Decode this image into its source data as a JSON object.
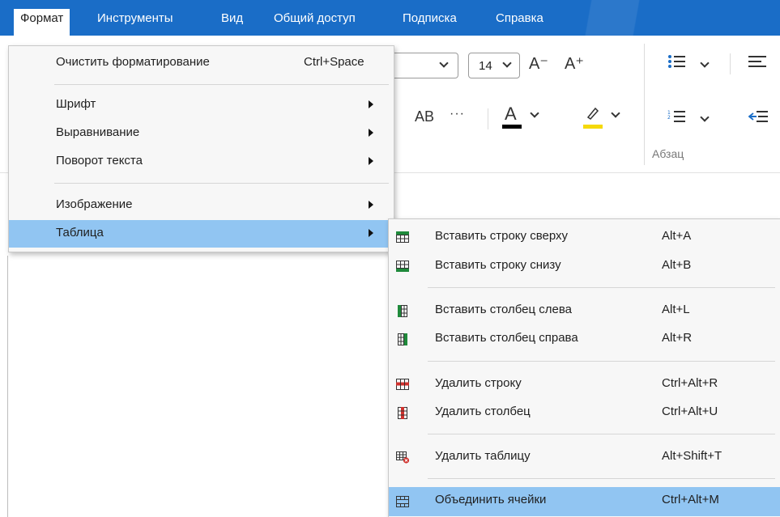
{
  "menubar": {
    "items": [
      {
        "label": "Формат"
      },
      {
        "label": "Инструменты"
      },
      {
        "label": "Вид"
      },
      {
        "label": "Общий доступ"
      },
      {
        "label": "Подписка"
      },
      {
        "label": "Справка"
      }
    ]
  },
  "ribbon": {
    "font_size": "14",
    "font_grow": "A⁻",
    "font_shrink": "A⁺",
    "caps": "AB",
    "more": "···",
    "font_color_glyph": "A",
    "group_paragraph": "Абзац",
    "colors": {
      "font_color_bar": "#000000",
      "highlight_bar": "#f5d90a"
    }
  },
  "format_menu": {
    "items": [
      {
        "label": "Очистить форматирование",
        "shortcut": "Ctrl+Space"
      },
      {
        "label": "Шрифт"
      },
      {
        "label": "Выравнивание"
      },
      {
        "label": "Поворот текста"
      },
      {
        "label": "Изображение"
      },
      {
        "label": "Таблица"
      }
    ]
  },
  "table_submenu": {
    "items": [
      {
        "label": "Вставить строку сверху",
        "shortcut": "Alt+A",
        "icon": "insert-row-above-icon"
      },
      {
        "label": "Вставить строку снизу",
        "shortcut": "Alt+B",
        "icon": "insert-row-below-icon"
      },
      {
        "label": "Вставить столбец слева",
        "shortcut": "Alt+L",
        "icon": "insert-column-left-icon"
      },
      {
        "label": "Вставить столбец справа",
        "shortcut": "Alt+R",
        "icon": "insert-column-right-icon"
      },
      {
        "label": "Удалить строку",
        "shortcut": "Ctrl+Alt+R",
        "icon": "delete-row-icon"
      },
      {
        "label": "Удалить столбец",
        "shortcut": "Ctrl+Alt+U",
        "icon": "delete-column-icon"
      },
      {
        "label": "Удалить таблицу",
        "shortcut": "Alt+Shift+T",
        "icon": "delete-table-icon"
      },
      {
        "label": "Объединить ячейки",
        "shortcut": "Ctrl+Alt+M",
        "icon": "merge-cells-icon"
      }
    ]
  },
  "colors": {
    "menubar": "#1a6dc7",
    "highlight": "#91c5f2",
    "menu_bg": "#f7f7f7",
    "icon_green": "#1f8a3b",
    "icon_red": "#d0312d"
  }
}
